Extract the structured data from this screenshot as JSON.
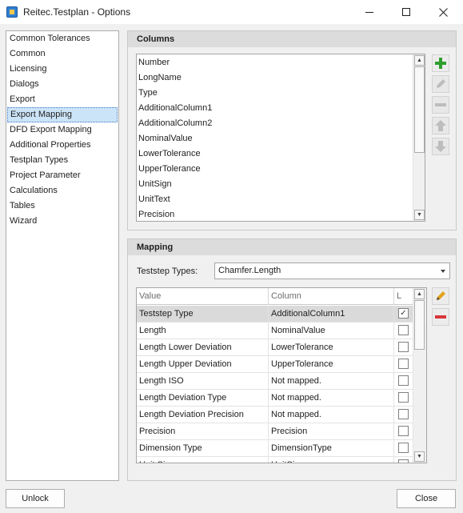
{
  "window": {
    "title": "Reitec.Testplan - Options"
  },
  "nav": {
    "items": [
      {
        "label": "Common Tolerances"
      },
      {
        "label": "Common"
      },
      {
        "label": "Licensing"
      },
      {
        "label": "Dialogs"
      },
      {
        "label": "Export"
      },
      {
        "label": "Export Mapping",
        "selected": true
      },
      {
        "label": "DFD Export Mapping"
      },
      {
        "label": "Additional Properties"
      },
      {
        "label": "Testplan Types"
      },
      {
        "label": "Project Parameter"
      },
      {
        "label": "Calculations"
      },
      {
        "label": "Tables"
      },
      {
        "label": "Wizard"
      }
    ]
  },
  "columns": {
    "header": "Columns",
    "items": [
      "Number",
      "LongName",
      "Type",
      "AdditionalColumn1",
      "AdditionalColumn2",
      "NominalValue",
      "LowerTolerance",
      "UpperTolerance",
      "UnitSign",
      "UnitText",
      "Precision"
    ],
    "buttons": [
      {
        "icon": "plus-icon",
        "enabled": true
      },
      {
        "icon": "pencil-icon",
        "enabled": false
      },
      {
        "icon": "minus-icon",
        "enabled": false
      },
      {
        "icon": "arrow-up-icon",
        "enabled": false
      },
      {
        "icon": "arrow-down-icon",
        "enabled": false
      }
    ]
  },
  "mapping": {
    "header": "Mapping",
    "teststep_label": "Teststep Types:",
    "teststep_value": "Chamfer.Length",
    "grid": {
      "headers": [
        "Value",
        "Column",
        "L"
      ],
      "rows": [
        {
          "value": "Teststep Type",
          "column": "AdditionalColumn1",
          "checked": true,
          "selected": true
        },
        {
          "value": "Length",
          "column": "NominalValue",
          "checked": false
        },
        {
          "value": "Length Lower Deviation",
          "column": "LowerTolerance",
          "checked": false
        },
        {
          "value": "Length Upper Deviation",
          "column": "UpperTolerance",
          "checked": false
        },
        {
          "value": "Length ISO",
          "column": "Not mapped.",
          "checked": false
        },
        {
          "value": "Length Deviation Type",
          "column": "Not mapped.",
          "checked": false
        },
        {
          "value": "Length Deviation Precision",
          "column": "Not mapped.",
          "checked": false
        },
        {
          "value": "Precision",
          "column": "Precision",
          "checked": false
        },
        {
          "value": "Dimension Type",
          "column": "DimensionType",
          "checked": false
        },
        {
          "value": "Unit Sign",
          "column": "UnitSign",
          "checked": false
        }
      ]
    },
    "buttons": [
      {
        "icon": "pencil-icon",
        "enabled": true
      },
      {
        "icon": "minus-icon",
        "enabled": true
      }
    ]
  },
  "footer": {
    "unlock_label": "Unlock",
    "close_label": "Close"
  },
  "colors": {
    "plus": "#2e9e2e",
    "remove": "#d9363e",
    "pencil": "#e2a21c",
    "selection": "#cce4f7"
  }
}
